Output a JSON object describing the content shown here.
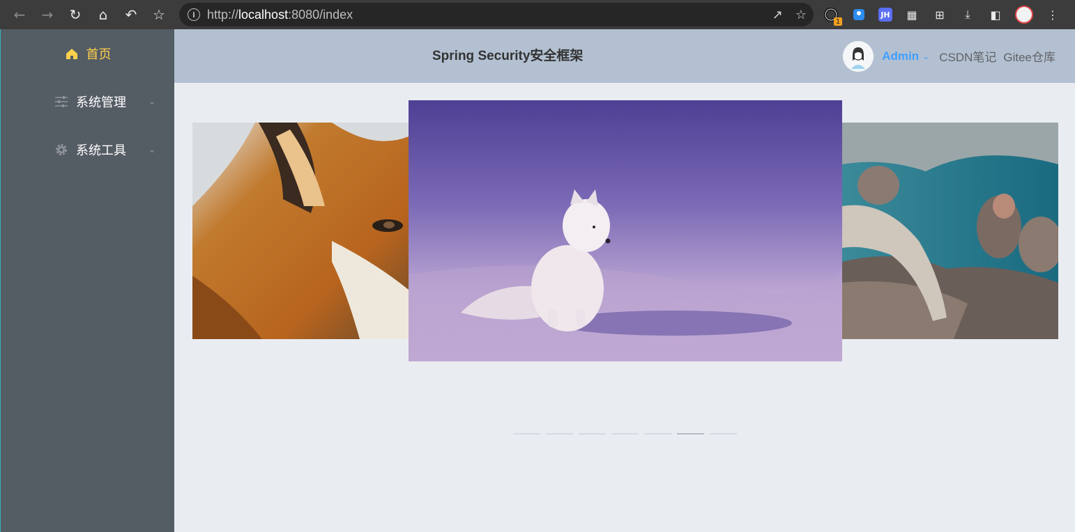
{
  "browser": {
    "url_scheme": "http://",
    "url_host": "localhost",
    "url_rest": ":8080/index",
    "extension_badge": "1",
    "extension_jh": "JH",
    "icons": [
      "back-arrow-icon",
      "forward-arrow-icon",
      "reload-icon",
      "home-icon",
      "undo-icon",
      "bookmark-star-icon",
      "info-icon",
      "share-icon",
      "star-icon",
      "extension-icon",
      "jh-icon",
      "grid-icon",
      "crop-icon",
      "download-icon",
      "sidepanel-icon",
      "profile-avatar",
      "kebab-menu-icon"
    ]
  },
  "sidebar": {
    "items": [
      {
        "label": "首页",
        "icon": "home-icon",
        "active": true
      },
      {
        "label": "系统管理",
        "icon": "sliders-icon",
        "active": false
      },
      {
        "label": "系统工具",
        "icon": "gear-icon",
        "active": false
      }
    ],
    "active_color": "#ffd04b",
    "background": "#545c64"
  },
  "header": {
    "title": "Spring Security安全框架",
    "user_name": "Admin",
    "links": [
      "CSDN笔记",
      "Gitee仓库"
    ],
    "background": "#b3c0d1",
    "accent": "#409eff"
  },
  "carousel": {
    "slides": [
      {
        "position": "left",
        "subject": "red fox"
      },
      {
        "position": "center",
        "subject": "arctic fox on snow"
      },
      {
        "position": "right",
        "subject": "snow monkeys at hot spring"
      }
    ],
    "indicator_count": 7,
    "active_indicator": 6
  }
}
